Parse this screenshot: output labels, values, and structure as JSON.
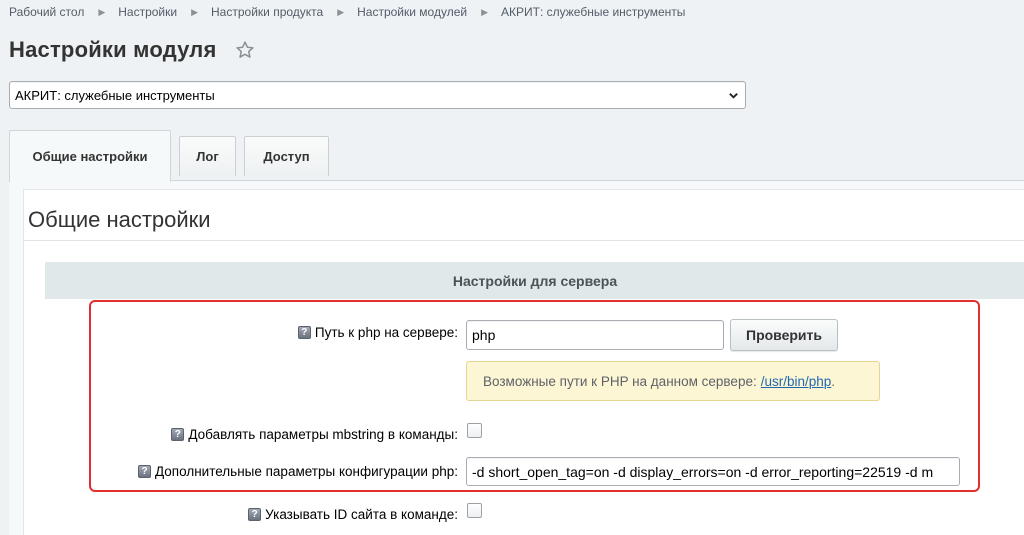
{
  "breadcrumb": [
    {
      "label": "Рабочий стол"
    },
    {
      "label": "Настройки"
    },
    {
      "label": "Настройки продукта"
    },
    {
      "label": "Настройки модулей"
    },
    {
      "label": "АКРИТ: служебные инструменты"
    }
  ],
  "page": {
    "title": "Настройки модуля",
    "favorite_icon": "star-outline-icon"
  },
  "module_select": {
    "selected": "АКРИТ: служебные инструменты"
  },
  "tabs": [
    {
      "label": "Общие настройки",
      "active": true
    },
    {
      "label": "Лог",
      "active": false
    },
    {
      "label": "Доступ",
      "active": false
    }
  ],
  "section": {
    "title": "Общие настройки",
    "server_header": "Настройки для сервера"
  },
  "fields": {
    "php_path": {
      "label": "Путь к php на сервере:",
      "value": "php",
      "button_label": "Проверить",
      "hint_text": "Возможные пути к PHP на данном сервере:",
      "hint_link": "/usr/bin/php",
      "hint_suffix": "."
    },
    "mbstring": {
      "label": "Добавлять параметры mbstring в команды:",
      "checked": false
    },
    "php_config": {
      "label": "Дополнительные параметры конфигурации php:",
      "value": "-d short_open_tag=on -d display_errors=on -d error_reporting=22519 -d m"
    },
    "site_id": {
      "label": "Указывать ID сайта в команде:",
      "checked": false
    }
  },
  "colors": {
    "highlight_border": "#e2302f",
    "link": "#2067b0",
    "hint_background": "#fdf6d4"
  }
}
